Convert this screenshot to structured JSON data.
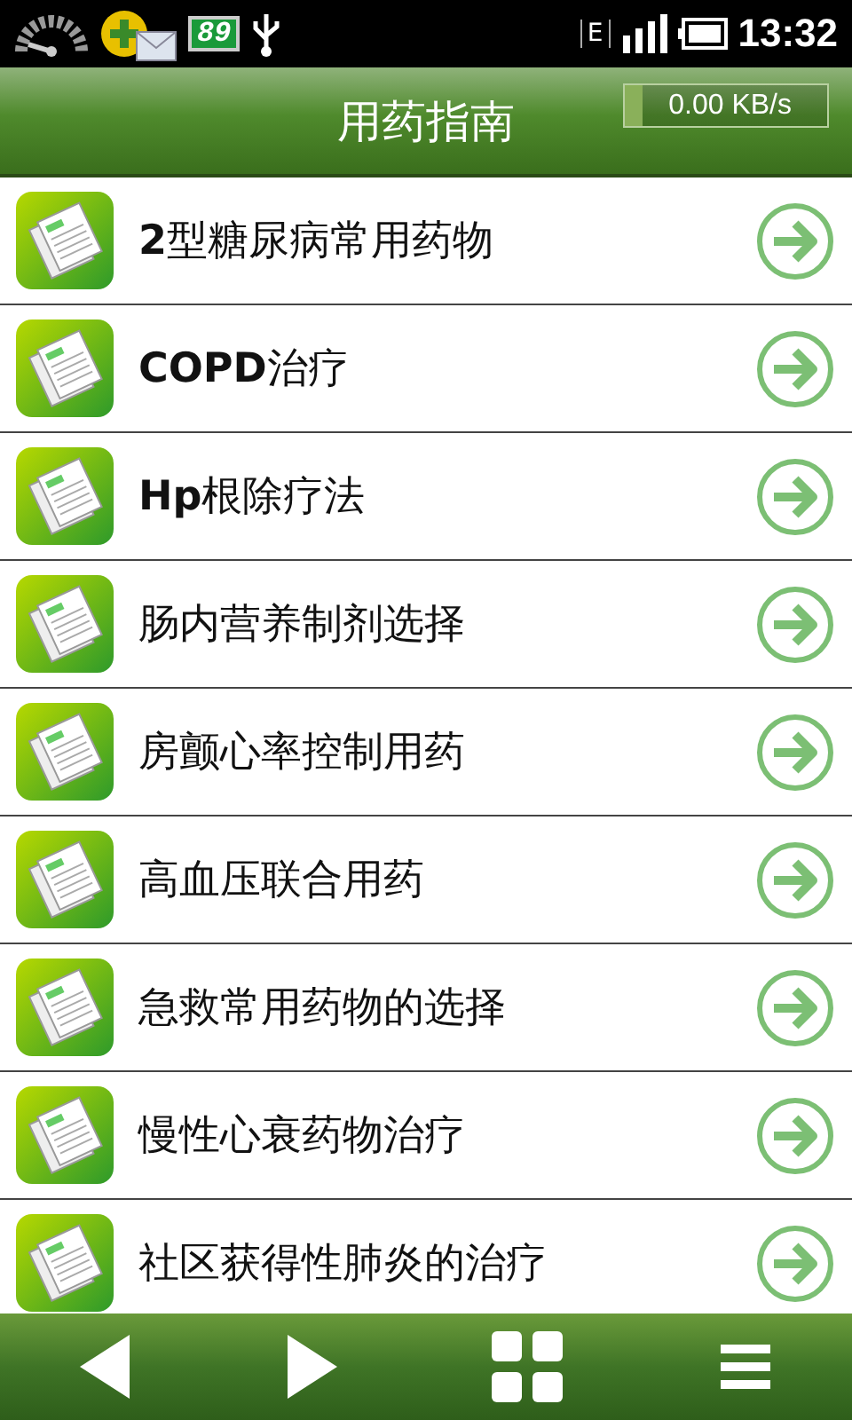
{
  "status_bar": {
    "badge": "89",
    "network": "E",
    "time": "13:32"
  },
  "header": {
    "title": "用药指南",
    "speed": "0.00 KB/s"
  },
  "items": [
    {
      "label": "**2**型糖尿病常用药物"
    },
    {
      "label": "**COPD**治疗"
    },
    {
      "label": "**Hp**根除疗法"
    },
    {
      "label": "肠内营养制剂选择"
    },
    {
      "label": "房颤心率控制用药"
    },
    {
      "label": "高血压联合用药"
    },
    {
      "label": "急救常用药物的选择"
    },
    {
      "label": "慢性心衰药物治疗"
    },
    {
      "label": "社区获得性肺炎的治疗"
    }
  ],
  "toolbar": [
    {
      "kind": "back"
    },
    {
      "kind": "forward"
    },
    {
      "kind": "grid"
    },
    {
      "kind": "menu"
    }
  ]
}
